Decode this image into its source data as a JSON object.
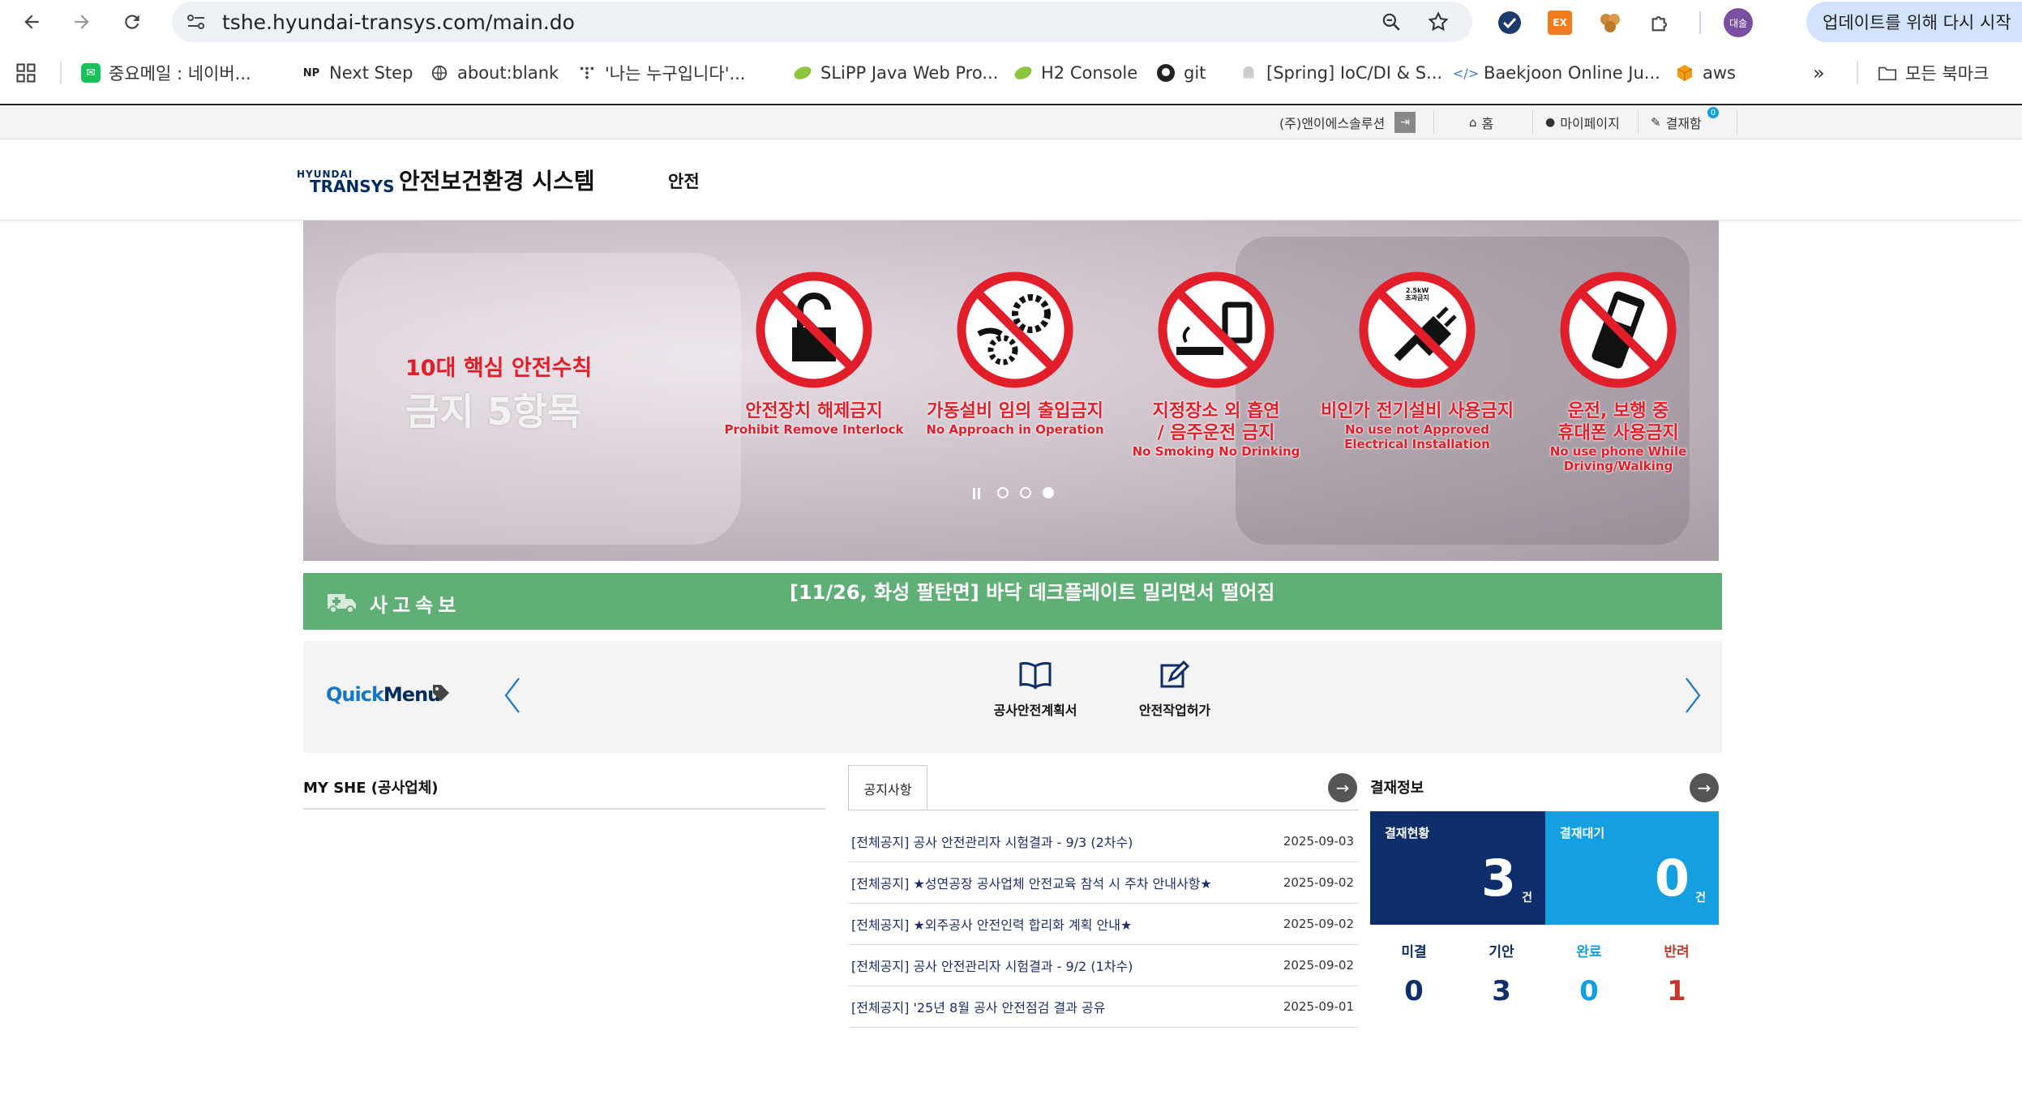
{
  "browser": {
    "url": "tshe.hyundai-transys.com/main.do",
    "update_button": "업데이트를 위해 다시 시작",
    "profile_initials": "대술",
    "ext_badge": "EX",
    "bookmarks": [
      "중요메일 : 네이버...",
      "Next Step",
      "about:blank",
      "'나는 누구입니다'...",
      "SLiPP Java Web Pro...",
      "H2 Console",
      "git",
      "[Spring] IoC/DI & S...",
      "Baekjoon Online Ju...",
      "aws"
    ],
    "bookmark_np": "NP",
    "all_bookmarks": "모든 북마크"
  },
  "util": {
    "company": "(주)앤이에스솔루션",
    "home": "홈",
    "mypage": "마이페이지",
    "approval": "결재함",
    "approval_badge": "0"
  },
  "header": {
    "logo_top": "HYUNDAI",
    "logo_main": "TRANSYS",
    "title": "안전보건환경 시스템",
    "nav_safety": "안전"
  },
  "hero": {
    "sub": "10대 핵심 안전수칙",
    "main": "금지 5항목",
    "signs": [
      {
        "ko": "안전장치 해제금지",
        "en": "Prohibit Remove Interlock"
      },
      {
        "ko": "가동설비 임의 출입금지",
        "en": "No Approach in Operation"
      },
      {
        "ko": "지정장소 외 흡연\n/ 음주운전 금지",
        "en": "No Smoking No Drinking"
      },
      {
        "ko": "비인가 전기설비 사용금지",
        "en": "No use not Approved\nElectrical Installation"
      },
      {
        "ko": "운전, 보행 중\n휴대폰 사용금지",
        "en": "No use phone While Driving/Walking"
      }
    ],
    "sign_badge": "2.5kW\n초과금지"
  },
  "news": {
    "label": "사고속보",
    "text": "[11/26, 화성 팔탄면] 바닥 데크플레이트 밀리면서 떨어짐"
  },
  "quick": {
    "title_a": "Quick",
    "title_b": "Menu",
    "items": [
      "공사안전계획서",
      "안전작업허가"
    ]
  },
  "myshe": {
    "title": "MY SHE (공사업체)"
  },
  "notice": {
    "tab": "공지사항",
    "rows": [
      {
        "title": "[전체공지] 공사 안전관리자 시험결과 - 9/3 (2차수)",
        "date": "2025-09-03"
      },
      {
        "title": "[전체공지] ★성연공장 공사업체 안전교육 참석 시 주차 안내사항★",
        "date": "2025-09-02"
      },
      {
        "title": "[전체공지] ★외주공사 안전인력 합리화 계획 안내★",
        "date": "2025-09-02"
      },
      {
        "title": "[전체공지] 공사 안전관리자 시험결과 - 9/2 (1차수)",
        "date": "2025-09-02"
      },
      {
        "title": "[전체공지] '25년 8월 공사 안전점검 결과 공유",
        "date": "2025-09-01"
      }
    ]
  },
  "approval": {
    "title": "결재정보",
    "status_label": "결재현황",
    "status_count": "3",
    "waiting_label": "결재대기",
    "waiting_count": "0",
    "unit": "건",
    "stats": [
      {
        "label": "미결",
        "value": "0",
        "color": "#0d2d6b"
      },
      {
        "label": "기안",
        "value": "3",
        "color": "#0d2d6b"
      },
      {
        "label": "완료",
        "value": "0",
        "color": "#139fe0"
      },
      {
        "label": "반려",
        "value": "1",
        "color": "#c0392b"
      }
    ]
  }
}
